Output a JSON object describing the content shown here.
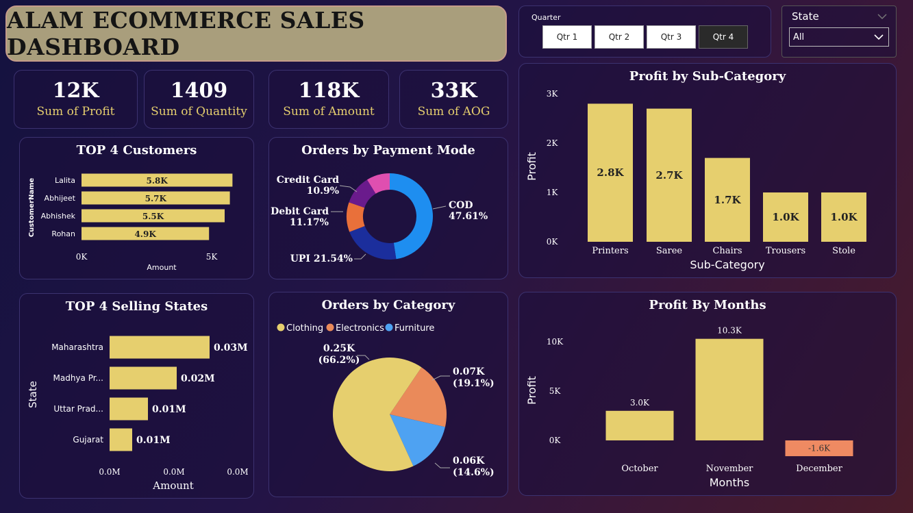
{
  "title": "ALAM ECOMMERCE SALES DASHBOARD",
  "quarter": {
    "label": "Quarter",
    "options": [
      "Qtr 1",
      "Qtr 2",
      "Qtr 3",
      "Qtr 4"
    ],
    "selected": "Qtr 4"
  },
  "state_filter": {
    "label": "State",
    "value": "All"
  },
  "kpis": [
    {
      "value": "12K",
      "label": "Sum of Profit"
    },
    {
      "value": "1409",
      "label": "Sum of Quantity"
    },
    {
      "value": "118K",
      "label": "Sum of Amount"
    },
    {
      "value": "33K",
      "label": "Sum of AOG"
    }
  ],
  "colors": {
    "yellow": "#e6cf6e",
    "negative": "#ef8a62",
    "cod": "#1e8ef0",
    "upi": "#1b2e9c",
    "debit": "#e9703a",
    "credit": "#6a1b8c",
    "other": "#df4fb0",
    "electronics": "#ea8a5a",
    "furniture": "#4ea2f2",
    "clothing": "#e6cf6e"
  },
  "chart_data": [
    {
      "type": "bar",
      "orientation": "horizontal",
      "title": "TOP 4 Customers",
      "ylabel": "CustomerName",
      "xlabel": "Amount",
      "categories": [
        "Lalita",
        "Abhijeet",
        "Abhishek",
        "Rohan"
      ],
      "values": [
        5.8,
        5.7,
        5.5,
        4.9
      ],
      "labels": [
        "5.8K",
        "5.7K",
        "5.5K",
        "4.9K"
      ],
      "xticks": [
        "0K",
        "5K"
      ],
      "xlim": [
        0,
        6
      ]
    },
    {
      "type": "pie",
      "variant": "donut",
      "title": "Orders by Payment Mode",
      "slices": [
        {
          "name": "COD",
          "value": 47.61,
          "label": "COD",
          "pct": "47.61%"
        },
        {
          "name": "UPI",
          "value": 21.54,
          "label": "UPI",
          "pct": "21.54%"
        },
        {
          "name": "Debit Card",
          "value": 11.17,
          "label": "Debit Card",
          "pct": "11.17%"
        },
        {
          "name": "Credit Card",
          "value": 10.9,
          "label": "Credit Card",
          "pct": "10.9%"
        },
        {
          "name": "",
          "value": 8.78,
          "label": "",
          "pct": ""
        }
      ]
    },
    {
      "type": "bar",
      "title": "Profit by Sub-Category",
      "xlabel": "Sub-Category",
      "ylabel": "Profit",
      "categories": [
        "Printers",
        "Saree",
        "Chairs",
        "Trousers",
        "Stole"
      ],
      "values": [
        2.8,
        2.7,
        1.7,
        1.0,
        1.0
      ],
      "labels": [
        "2.8K",
        "2.7K",
        "1.7K",
        "1.0K",
        "1.0K"
      ],
      "yticks": [
        "0K",
        "1K",
        "2K",
        "3K"
      ],
      "ylim": [
        0,
        3
      ]
    },
    {
      "type": "bar",
      "orientation": "horizontal",
      "title": "TOP 4 Selling States",
      "xlabel": "Amount",
      "ylabel": "State",
      "categories": [
        "Maharashtra",
        "Madhya Pr...",
        "Uttar Prad...",
        "Gujarat"
      ],
      "values": [
        0.03,
        0.02,
        0.01,
        0.01
      ],
      "labels": [
        "0.03M",
        "0.02M",
        "0.01M",
        "0.01M"
      ],
      "xticks": [
        "0.0M",
        "0.0M",
        "0.0M"
      ]
    },
    {
      "type": "pie",
      "title": "Orders by Category",
      "legend": [
        "Clothing",
        "Electronics",
        "Furniture"
      ],
      "slices": [
        {
          "name": "Clothing",
          "value": 66.2,
          "label": "0.25K",
          "pct": "(66.2%)"
        },
        {
          "name": "Electronics",
          "value": 19.1,
          "label": "0.07K",
          "pct": "(19.1%)"
        },
        {
          "name": "Furniture",
          "value": 14.6,
          "label": "0.06K",
          "pct": "(14.6%)"
        }
      ]
    },
    {
      "type": "bar",
      "title": "Profit By Months",
      "xlabel": "Months",
      "ylabel": "Profit",
      "categories": [
        "October",
        "November",
        "December"
      ],
      "values": [
        3.0,
        10.3,
        -1.6
      ],
      "labels": [
        "3.0K",
        "10.3K",
        "-1.6K"
      ],
      "yticks": [
        "0K",
        "5K",
        "10K"
      ],
      "ylim": [
        -1.6,
        11
      ]
    }
  ]
}
